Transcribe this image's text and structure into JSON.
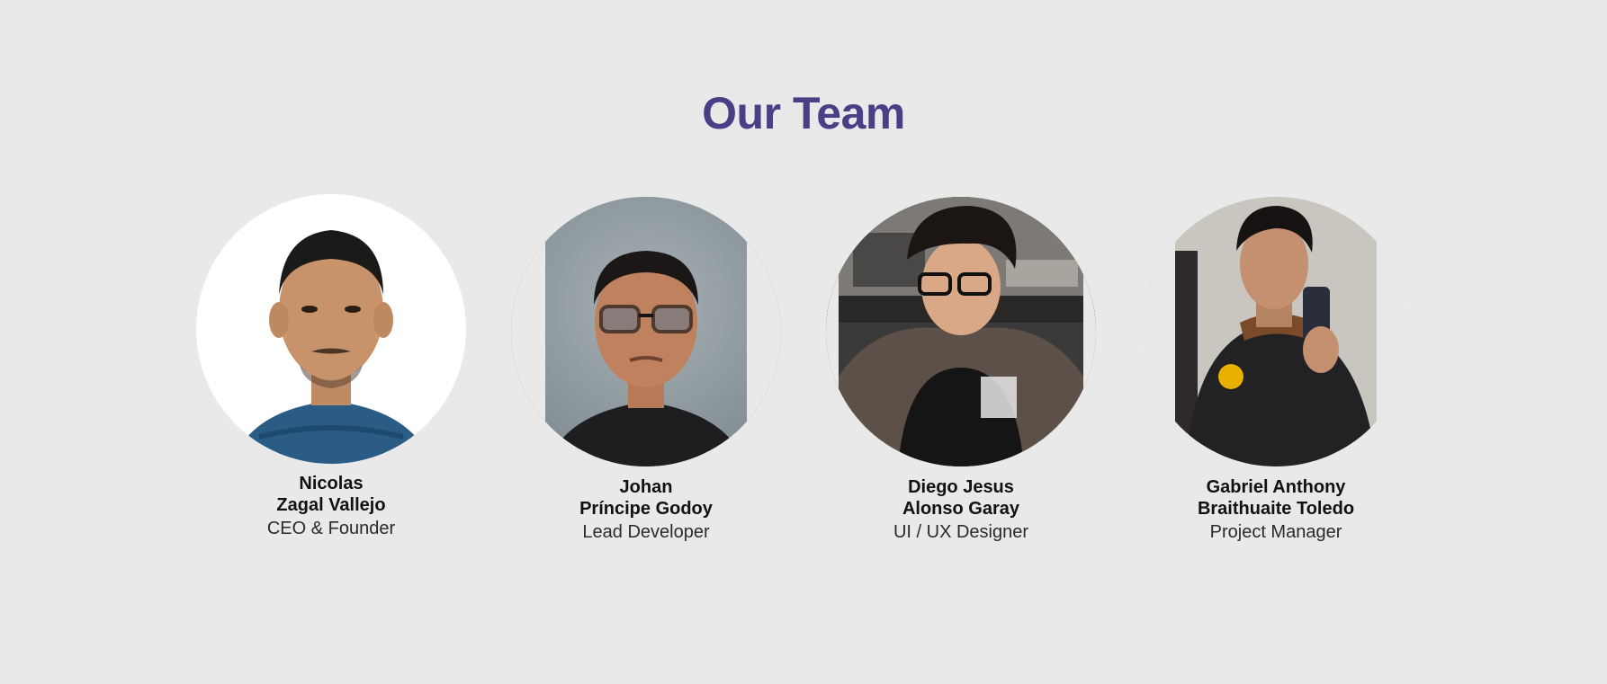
{
  "section": {
    "title": "Our Team"
  },
  "colors": {
    "background": "#e9e9e9",
    "title": "#4a3f85",
    "name": "#111111",
    "role": "#2a2a2a"
  },
  "members": [
    {
      "name_line1": "Nicolas",
      "name_line2": "Zagal Vallejo",
      "role": "CEO & Founder",
      "photo": "portrait-photo"
    },
    {
      "name_line1": "Johan",
      "name_line2": "Príncipe Godoy",
      "role": "Lead Developer",
      "photo": "portrait-photo"
    },
    {
      "name_line1": "Diego Jesus",
      "name_line2": "Alonso Garay",
      "role": "UI / UX Designer",
      "photo": "portrait-photo"
    },
    {
      "name_line1": "Gabriel Anthony",
      "name_line2": "Braithuaite Toledo",
      "role": "Project Manager",
      "photo": "portrait-photo"
    }
  ]
}
